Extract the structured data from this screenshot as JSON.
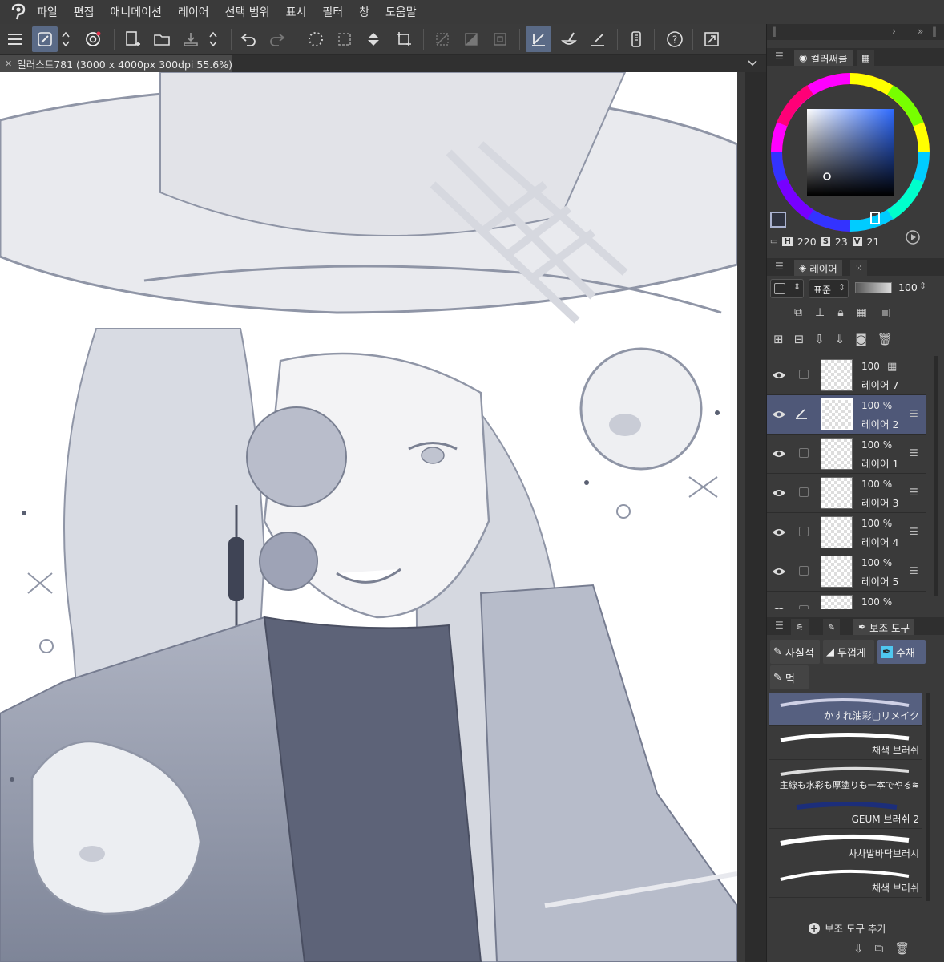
{
  "menubar": {
    "items": [
      "파일",
      "편집",
      "애니메이션",
      "레이어",
      "선택 범위",
      "표시",
      "필터",
      "창",
      "도움말"
    ]
  },
  "document_tab": {
    "title": "일러스트781 (3000 x 4000px 300dpi 55.6%)"
  },
  "color_panel": {
    "tab_label": "컬러써클",
    "h_label": "H",
    "h_value": "220",
    "s_label": "S",
    "s_value": "23",
    "v_label": "V",
    "v_value": "21"
  },
  "layer_panel": {
    "tab_label": "레이어",
    "blend_mode": "표준",
    "opacity": "100",
    "layers": [
      {
        "name": "레이어 7",
        "opacity": "100"
      },
      {
        "name": "레이어 2",
        "opacity": "100 %"
      },
      {
        "name": "레이어 1",
        "opacity": "100 %"
      },
      {
        "name": "레이어 3",
        "opacity": "100 %"
      },
      {
        "name": "레이어 4",
        "opacity": "100 %"
      },
      {
        "name": "레이어 5",
        "opacity": "100 %"
      },
      {
        "name": "",
        "opacity": "100 %"
      }
    ]
  },
  "subtool_panel": {
    "tab_label": "보조 도구",
    "groups": [
      "사실적",
      "두껍게",
      "수채",
      "먹"
    ],
    "brushes": [
      "かすれ油彩▢リメイク",
      "채색 브러쉬",
      "主線も水彩も厚塗りも一本でやる≋",
      "GEUM 브러쉬 2",
      "차차발바닥브러시",
      "채색 브러쉬"
    ],
    "add_label": "보조 도구 추가"
  },
  "colors": {
    "menubar": "#3a3a3a",
    "panel": "#3a3a3a",
    "selected": "#4f5878",
    "accent": "#5a6a86"
  }
}
